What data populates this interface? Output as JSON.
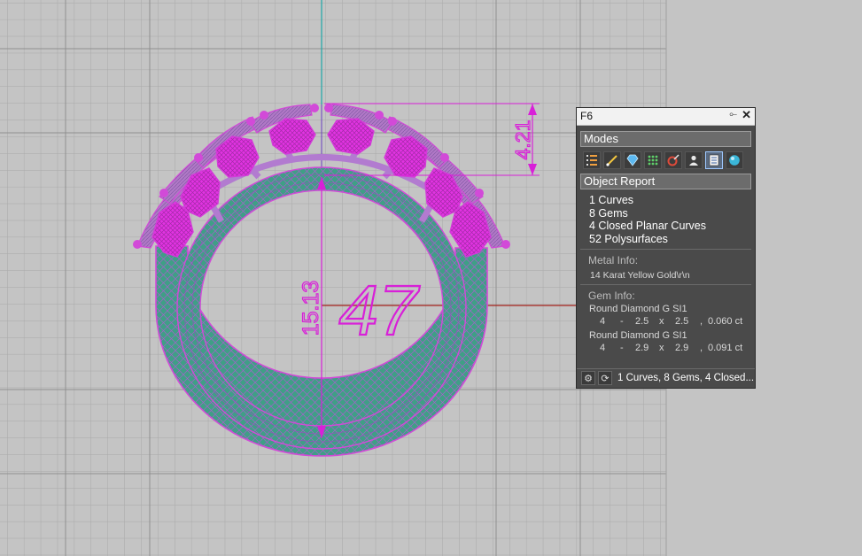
{
  "viewport": {
    "ring_size_label": "47",
    "inner_diameter_label": "15.13",
    "head_height_label": "4.21"
  },
  "panel": {
    "title": "F6",
    "pin_glyph": "⟜",
    "close_glyph": "✕",
    "modes_header": "Modes",
    "mode_icons": [
      "list-icon",
      "curve-icon",
      "gem-icon",
      "mesh-icon",
      "pipe-icon",
      "user-icon",
      "report-icon",
      "sphere-icon"
    ],
    "active_mode": "report-icon",
    "report_header": "Object Report",
    "summary": [
      "1 Curves",
      "8 Gems",
      "4 Closed Planar Curves",
      "52 Polysurfaces"
    ],
    "metal_title": "Metal Info:",
    "metal_value": "14 Karat Yellow Gold\\r\\n",
    "gem_title": "Gem Info:",
    "gems": [
      {
        "name": "Round  Diamond  G  SI1",
        "count": "4",
        "dash": "-",
        "w": "2.5",
        "x": "x",
        "h": "2.5",
        "comma": ",",
        "carat": "0.060 ct"
      },
      {
        "name": "Round  Diamond  G  SI1",
        "count": "4",
        "dash": "-",
        "w": "2.9",
        "x": "x",
        "h": "2.9",
        "comma": ",",
        "carat": "0.091 ct"
      }
    ],
    "status_text": "1 Curves, 8 Gems, 4 Closed..."
  }
}
